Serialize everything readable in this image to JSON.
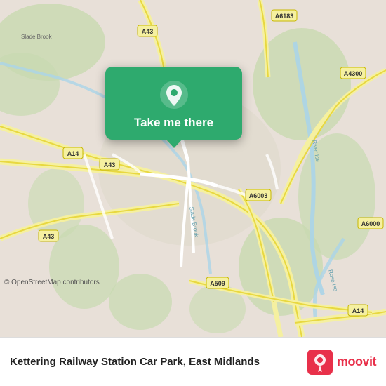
{
  "map": {
    "attribution": "© OpenStreetMap contributors",
    "background_color": "#e8e0d8"
  },
  "cta": {
    "label": "Take me there",
    "pin_icon": "map-pin"
  },
  "bottom_bar": {
    "location_name": "Kettering Railway Station Car Park, East Midlands",
    "moovit_label": "moovit"
  },
  "road_labels": [
    "A43",
    "A43",
    "A43",
    "A14",
    "A6183",
    "A4300",
    "A6003",
    "A509",
    "A6000",
    "A14"
  ]
}
